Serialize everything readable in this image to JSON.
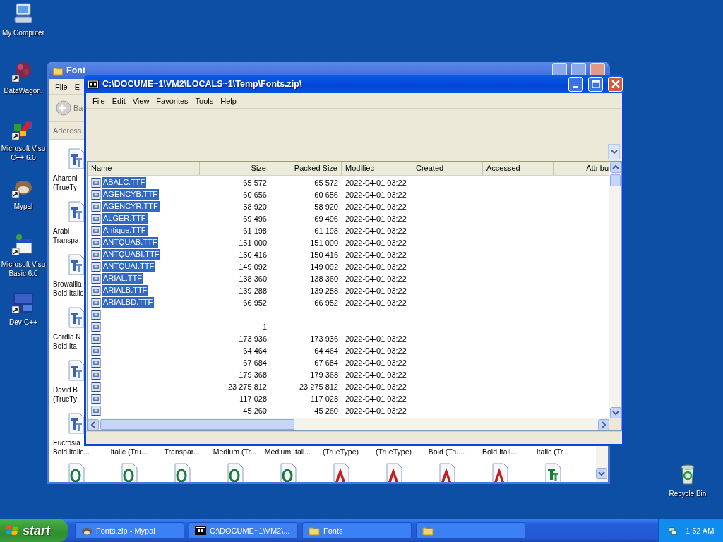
{
  "desktop_icons": [
    {
      "kind": "computer",
      "label": [
        "My Computer"
      ],
      "shortcut": false
    },
    {
      "kind": "dots",
      "label": [
        "DataWagon."
      ],
      "shortcut": true
    },
    {
      "kind": "vcpp",
      "label": [
        "Microsoft Visu",
        "C++ 6.0"
      ],
      "shortcut": true
    },
    {
      "kind": "mypal",
      "label": [
        "Mypal"
      ],
      "shortcut": true
    },
    {
      "kind": "vb",
      "label": [
        "Microsoft Visu",
        "Basic 6.0"
      ],
      "shortcut": true
    },
    {
      "kind": "dev",
      "label": [
        "Dev-C++"
      ],
      "shortcut": true
    }
  ],
  "recycle_bin": {
    "label": "Recycle Bin"
  },
  "fonts_window": {
    "title": "Font",
    "menu": [
      "File",
      "E"
    ],
    "back_label": "Ba",
    "address_label": "Address",
    "left_items": [
      {
        "kind": "truetype",
        "label": [
          "Aharoni",
          "(TrueTy"
        ]
      },
      {
        "kind": "truetype",
        "label": [
          "Arabi",
          "Transpa"
        ]
      },
      {
        "kind": "truetype",
        "label": [
          "Browallia",
          "Bold Italic"
        ]
      },
      {
        "kind": "truetype",
        "label": [
          "Cordia N",
          "Bold Ita"
        ]
      },
      {
        "kind": "truetype",
        "label": [
          "David B",
          "(TrueTy"
        ]
      },
      {
        "kind": "truetype",
        "label": [
          "Eucrosia",
          "Bold Italic..."
        ]
      }
    ],
    "bottom_labels": [
      "Italic (Tru...",
      "Transpar...",
      "Medium (Tr...",
      "Medium Itali...",
      "(TrueType)",
      "(TrueType)",
      "Bold (Tru...",
      "Bold Itali...",
      "Italic (Tr..."
    ],
    "bottom_icons": [
      {
        "kind": "opentype"
      },
      {
        "kind": "opentype"
      },
      {
        "kind": "opentype"
      },
      {
        "kind": "opentype"
      },
      {
        "kind": "opentype"
      },
      {
        "kind": "postscript"
      },
      {
        "kind": "postscript"
      },
      {
        "kind": "postscript"
      },
      {
        "kind": "postscript"
      },
      {
        "kind": "truetype"
      }
    ]
  },
  "archive_window": {
    "title": "C:\\DOCUME~1\\VM2\\LOCALS~1\\Temp\\Fonts.zip\\",
    "menu": [
      "File",
      "Edit",
      "View",
      "Favorites",
      "Tools",
      "Help"
    ],
    "columns": [
      "Name",
      "Size",
      "Packed Size",
      "Modified",
      "Created",
      "Accessed",
      "Attribu"
    ],
    "rows": [
      {
        "name": "ABALC.TTF",
        "size": "65 572",
        "packed": "65 572",
        "modified": "2022-04-01 03:22",
        "selected": true
      },
      {
        "name": "AGENCYB.TTF",
        "size": "60 656",
        "packed": "60 656",
        "modified": "2022-04-01 03:22",
        "selected": true
      },
      {
        "name": "AGENCYR.TTF",
        "size": "58 920",
        "packed": "58 920",
        "modified": "2022-04-01 03:22",
        "selected": true
      },
      {
        "name": "ALGER.TTF",
        "size": "69 496",
        "packed": "69 496",
        "modified": "2022-04-01 03:22",
        "selected": true
      },
      {
        "name": "Antique.TTF",
        "size": "61 198",
        "packed": "61 198",
        "modified": "2022-04-01 03:22",
        "selected": true
      },
      {
        "name": "ANTQUAB.TTF",
        "size": "151 000",
        "packed": "151 000",
        "modified": "2022-04-01 03:22",
        "selected": true
      },
      {
        "name": "ANTQUABI.TTF",
        "size": "150 416",
        "packed": "150 416",
        "modified": "2022-04-01 03:22",
        "selected": true
      },
      {
        "name": "ANTQUAI.TTF",
        "size": "149 092",
        "packed": "149 092",
        "modified": "2022-04-01 03:22",
        "selected": true
      },
      {
        "name": "ARIAL.TTF",
        "size": "138 360",
        "packed": "138 360",
        "modified": "2022-04-01 03:22",
        "selected": true
      },
      {
        "name": "ARIALB.TTF",
        "size": "139 288",
        "packed": "139 288",
        "modified": "2022-04-01 03:22",
        "selected": true
      },
      {
        "name": "ARIALBD.TTF",
        "size": "66 952",
        "packed": "66 952",
        "modified": "2022-04-01 03:22",
        "selected": true
      },
      {
        "selected": false
      },
      {
        "size": "1",
        "selected": false
      },
      {
        "size": "173 936",
        "packed": "173 936",
        "modified": "2022-04-01 03:22",
        "selected": false
      },
      {
        "size": "64 464",
        "packed": "64 464",
        "modified": "2022-04-01 03:22",
        "selected": false
      },
      {
        "size": "67 684",
        "packed": "67 684",
        "modified": "2022-04-01 03:22",
        "selected": false
      },
      {
        "size": "179 368",
        "packed": "179 368",
        "modified": "2022-04-01 03:22",
        "selected": false
      },
      {
        "size": "23 275 812",
        "packed": "23 275 812",
        "modified": "2022-04-01 03:22",
        "selected": false
      },
      {
        "size": "117 028",
        "packed": "117 028",
        "modified": "2022-04-01 03:22",
        "selected": false
      },
      {
        "size": "45 260",
        "packed": "45 260",
        "modified": "2022-04-01 03:22",
        "selected": false
      }
    ]
  },
  "taskbar": {
    "start": "start",
    "tasks": [
      {
        "kind": "mypal",
        "label": "Fonts.zip - Mypal"
      },
      {
        "kind": "archive",
        "label": "C:\\DOCUME~1\\VM2\\..."
      },
      {
        "kind": "folder",
        "label": "Fonts"
      },
      {
        "kind": "folder"
      }
    ],
    "clock": "1:52 AM"
  }
}
